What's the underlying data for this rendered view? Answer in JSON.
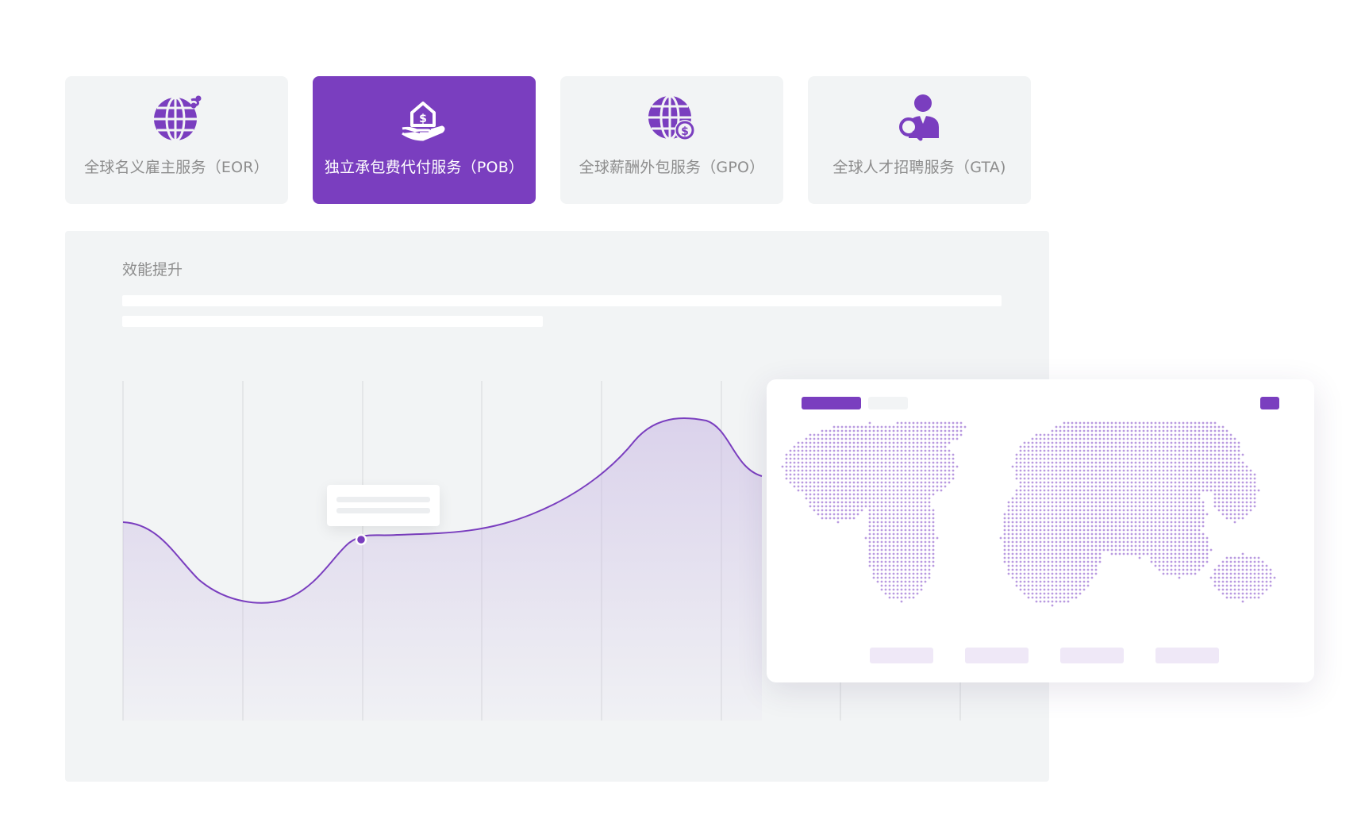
{
  "tabs": [
    {
      "label": "全球名义雇主服务（EOR）",
      "icon": "globe-icon",
      "active": false
    },
    {
      "label": "独立承包费代付服务（POB）",
      "icon": "hand-money-house-icon",
      "active": true
    },
    {
      "label": "全球薪酬外包服务（GPO）",
      "icon": "globe-dollar-icon",
      "active": false
    },
    {
      "label": "全球人才招聘服务（GTA)",
      "icon": "person-search-icon",
      "active": false
    }
  ],
  "panel": {
    "title": "效能提升"
  },
  "colors": {
    "accent": "#7a3ebf",
    "panel_bg": "#f2f4f5",
    "label_gray": "#8d8d8d",
    "map_dot": "#b99ae0"
  },
  "map_card": {
    "icon": "world-map-dotted"
  }
}
